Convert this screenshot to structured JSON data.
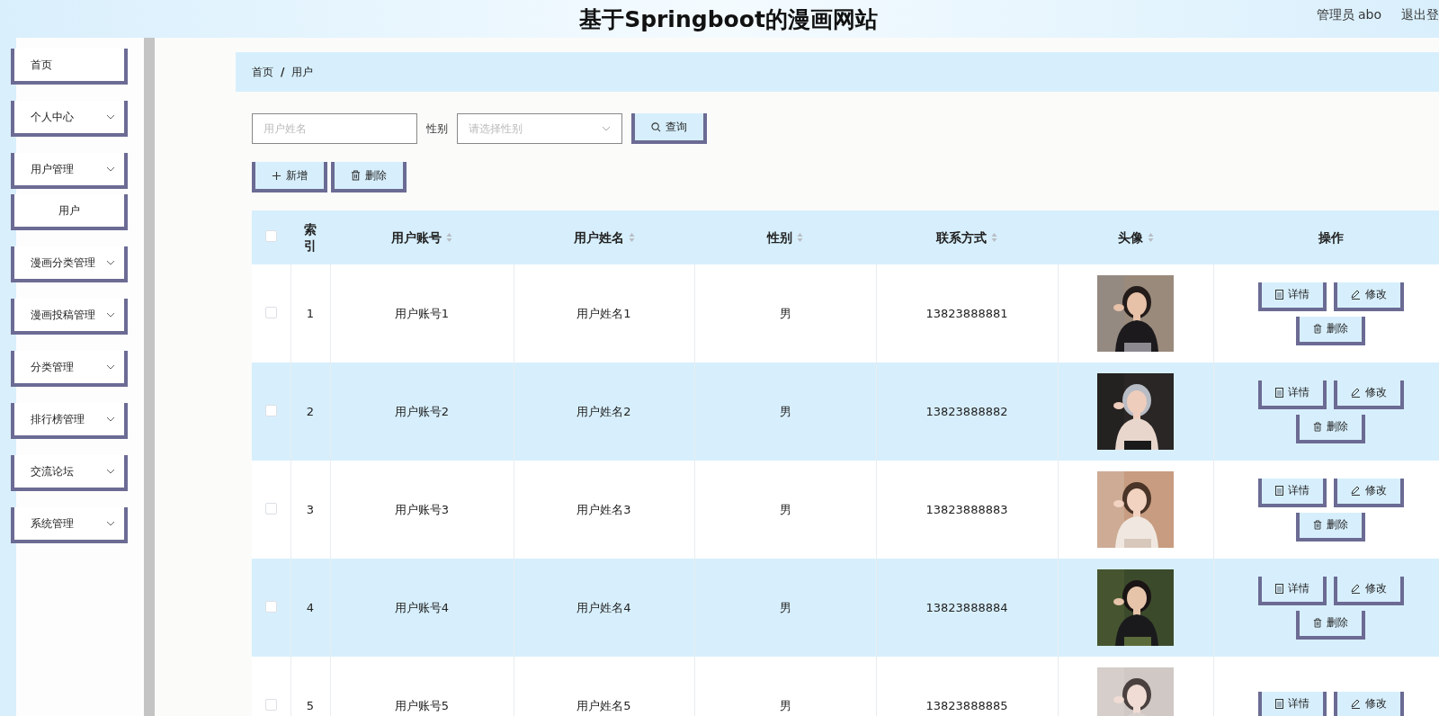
{
  "header": {
    "title": "基于Springboot的漫画网站",
    "user": "管理员 abo",
    "logout": "退出登"
  },
  "sidebar": {
    "items": [
      {
        "label": "首页",
        "kind": "link"
      },
      {
        "label": "个人中心",
        "kind": "menu"
      },
      {
        "label": "用户管理",
        "kind": "menu",
        "children": [
          {
            "label": "用户"
          }
        ]
      },
      {
        "label": "漫画分类管理",
        "kind": "menu"
      },
      {
        "label": "漫画投稿管理",
        "kind": "menu"
      },
      {
        "label": "分类管理",
        "kind": "menu"
      },
      {
        "label": "排行榜管理",
        "kind": "menu"
      },
      {
        "label": "交流论坛",
        "kind": "menu"
      },
      {
        "label": "系统管理",
        "kind": "menu"
      }
    ]
  },
  "breadcrumb": {
    "items": [
      "首页",
      "用户"
    ],
    "separator": "/"
  },
  "search": {
    "name_placeholder": "用户姓名",
    "gender_label": "性别",
    "gender_placeholder": "请选择性别",
    "query_button": "查询"
  },
  "toolbar": {
    "add_button": "新增",
    "delete_button": "删除"
  },
  "table": {
    "header_checked": false,
    "columns": [
      {
        "label": "索引",
        "sortable": false
      },
      {
        "label": "用户账号",
        "sortable": true
      },
      {
        "label": "用户姓名",
        "sortable": true
      },
      {
        "label": "性别",
        "sortable": true
      },
      {
        "label": "联系方式",
        "sortable": true
      },
      {
        "label": "头像",
        "sortable": true
      },
      {
        "label": "操作",
        "sortable": false
      }
    ],
    "rows": [
      {
        "checked": false,
        "index": "1",
        "account": "用户账号1",
        "name": "用户姓名1",
        "gender": "男",
        "phone": "13823888881",
        "avatar": {
          "kind": "picture"
        },
        "actions": [
          "详情",
          "修改",
          "删除"
        ]
      },
      {
        "checked": false,
        "index": "2",
        "account": "用户账号2",
        "name": "用户姓名2",
        "gender": "男",
        "phone": "13823888882",
        "avatar": {
          "kind": "picture"
        },
        "actions": [
          "详情",
          "修改",
          "删除"
        ]
      },
      {
        "checked": false,
        "index": "3",
        "account": "用户账号3",
        "name": "用户姓名3",
        "gender": "男",
        "phone": "13823888883",
        "avatar": {
          "kind": "picture"
        },
        "actions": [
          "详情",
          "修改",
          "删除"
        ]
      },
      {
        "checked": false,
        "index": "4",
        "account": "用户账号4",
        "name": "用户姓名4",
        "gender": "男",
        "phone": "13823888884",
        "avatar": {
          "kind": "picture"
        },
        "actions": [
          "详情",
          "修改",
          "删除"
        ]
      },
      {
        "checked": false,
        "index": "5",
        "account": "用户账号5",
        "name": "用户姓名5",
        "gender": "男",
        "phone": "13823888885",
        "avatar": {
          "kind": "picture"
        },
        "actions": [
          "详情",
          "修改"
        ]
      }
    ]
  }
}
